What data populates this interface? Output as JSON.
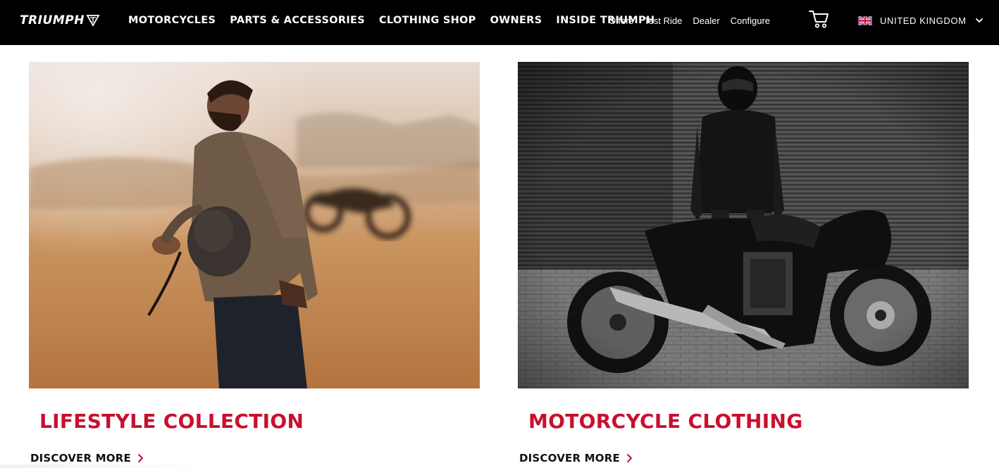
{
  "header": {
    "logo_text": "TRIUMPH",
    "main_nav": [
      "MOTORCYCLES",
      "PARTS & ACCESSORIES",
      "CLOTHING SHOP",
      "OWNERS",
      "INSIDE TRIUMPH"
    ],
    "util_nav": [
      "Offers",
      "Test Ride",
      "Dealer",
      "Configure"
    ],
    "region_label": "UNITED KINGDOM"
  },
  "cards": [
    {
      "title": "LIFESTYLE COLLECTION",
      "cta": "DISCOVER MORE"
    },
    {
      "title": "MOTORCYCLE CLOTHING",
      "cta": "DISCOVER MORE"
    }
  ],
  "icons": {
    "cart": "cart-icon",
    "flag": "uk-flag-icon",
    "region_chevron": "chevron-down-icon",
    "cta_chevron": "chevron-right-icon"
  },
  "colors": {
    "header_bg": "#000000",
    "title_red": "#c8102e",
    "text_dark": "#111111"
  }
}
